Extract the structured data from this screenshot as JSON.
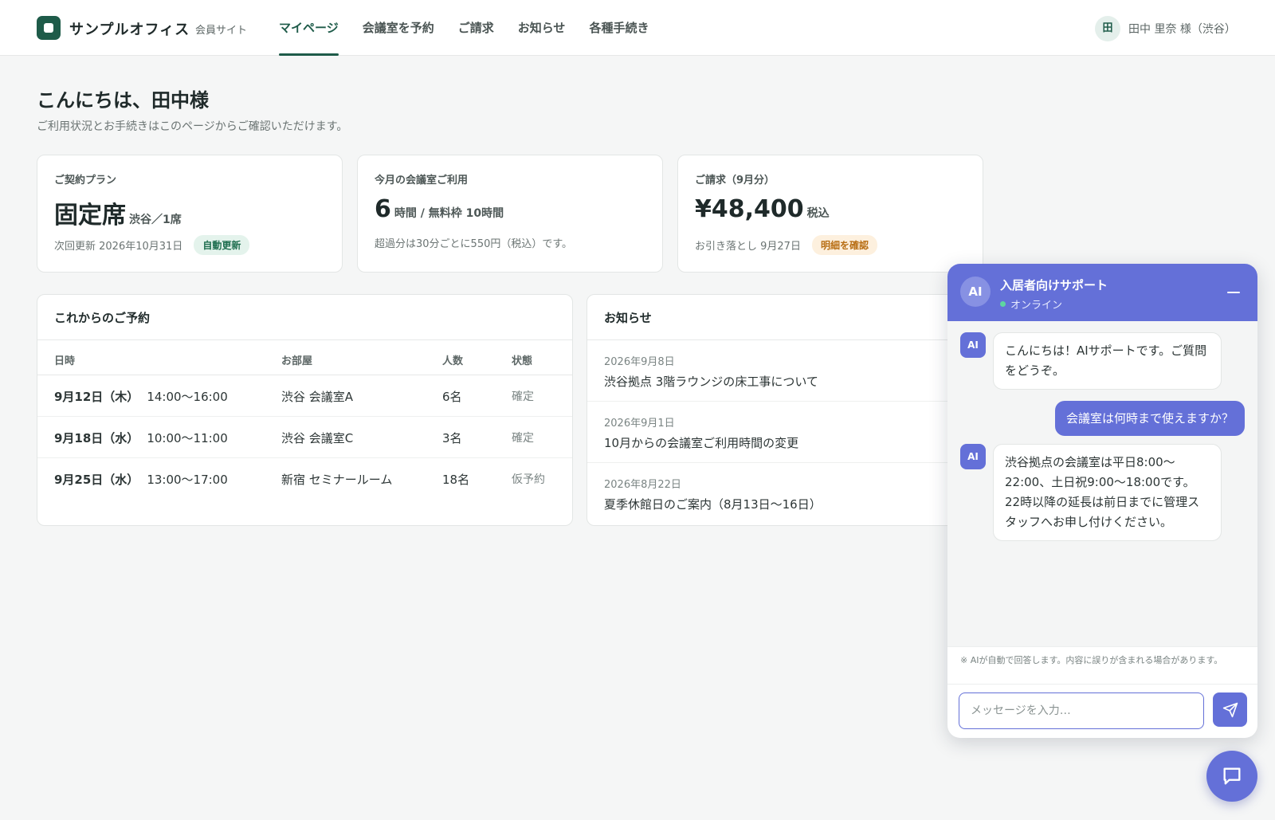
{
  "header": {
    "brand": "サンプルオフィス",
    "brand_sub": "会員サイト",
    "nav": [
      "マイページ",
      "会議室を予約",
      "ご請求",
      "お知らせ",
      "各種手続き"
    ],
    "user_avatar": "田",
    "user_name": "田中 里奈 様（渋谷）"
  },
  "greeting": {
    "title": "こんにちは、田中様",
    "subtitle": "ご利用状況とお手続きはこのページからご確認いただけます。"
  },
  "stats": {
    "plan": {
      "label": "ご契約プラン",
      "value": "固定席",
      "unit": "渋谷／1席",
      "foot": "次回更新 2026年10月31日",
      "badge": "自動更新"
    },
    "usage": {
      "label": "今月の会議室ご利用",
      "value": "6",
      "unit": "時間 / 無料枠 10時間",
      "foot": "超過分は30分ごとに550円（税込）です。"
    },
    "billing": {
      "label": "ご請求（9月分）",
      "value": "¥48,400",
      "unit": "税込",
      "foot": "お引き落とし 9月27日",
      "badge": "明細を確認"
    }
  },
  "reservations": {
    "title": "これからのご予約",
    "columns": [
      "日時",
      "お部屋",
      "人数",
      "状態"
    ],
    "rows": [
      {
        "date": "9月12日（木）",
        "time": "14:00〜16:00",
        "room": "渋谷 会議室A",
        "people": "6名",
        "status": "確定"
      },
      {
        "date": "9月18日（水）",
        "time": "10:00〜11:00",
        "room": "渋谷 会議室C",
        "people": "3名",
        "status": "確定"
      },
      {
        "date": "9月25日（水）",
        "time": "13:00〜17:00",
        "room": "新宿 セミナールーム",
        "people": "18名",
        "status": "仮予約"
      }
    ]
  },
  "news": {
    "title": "お知らせ",
    "items": [
      {
        "date": "2026年9月8日",
        "title": "渋谷拠点 3階ラウンジの床工事について"
      },
      {
        "date": "2026年9月1日",
        "title": "10月からの会議室ご利用時間の変更"
      },
      {
        "date": "2026年8月22日",
        "title": "夏季休館日のご案内（8月13日〜16日）"
      }
    ]
  },
  "chat": {
    "avatar": "AI",
    "title": "入居者向けサポート",
    "status": "オンライン",
    "messages": [
      {
        "from": "bot",
        "text": "こんにちは！AIサポートです。ご質問をどうぞ。"
      },
      {
        "from": "user",
        "text": "会議室は何時まで使えますか？"
      },
      {
        "from": "bot",
        "text": "渋谷拠点の会議室は平日8:00〜22:00、土日祝9:00〜18:00です。22時以降の延長は前日までに管理スタッフへお申し付けください。"
      }
    ],
    "note": "※ AIが自動で回答します。内容に誤りが含まれる場合があります。",
    "input_placeholder": "メッセージを入力…"
  },
  "colors": {
    "brand": "#1e5b49",
    "accent": "#6470d8"
  }
}
